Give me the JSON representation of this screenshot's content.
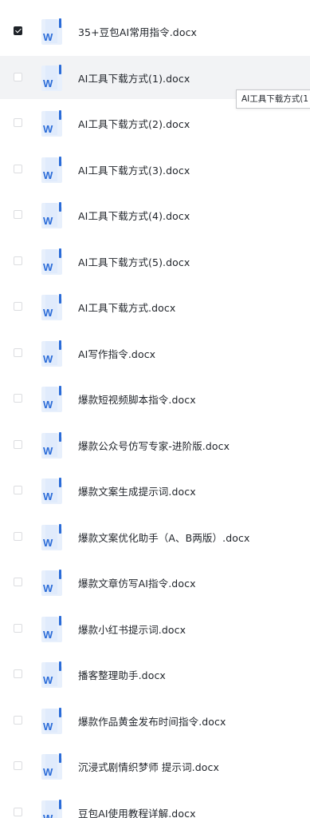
{
  "files": [
    {
      "name": "35+豆包AI常用指令.docx",
      "checked": true,
      "hovered": false
    },
    {
      "name": "AI工具下载方式(1).docx",
      "checked": false,
      "hovered": true
    },
    {
      "name": "AI工具下载方式(2).docx",
      "checked": false,
      "hovered": false
    },
    {
      "name": "AI工具下载方式(3).docx",
      "checked": false,
      "hovered": false
    },
    {
      "name": "AI工具下载方式(4).docx",
      "checked": false,
      "hovered": false
    },
    {
      "name": "AI工具下载方式(5).docx",
      "checked": false,
      "hovered": false
    },
    {
      "name": "AI工具下载方式.docx",
      "checked": false,
      "hovered": false
    },
    {
      "name": "AI写作指令.docx",
      "checked": false,
      "hovered": false
    },
    {
      "name": "爆款短视频脚本指令.docx",
      "checked": false,
      "hovered": false
    },
    {
      "name": "爆款公众号仿写专家-进阶版.docx",
      "checked": false,
      "hovered": false
    },
    {
      "name": "爆款文案生成提示词.docx",
      "checked": false,
      "hovered": false
    },
    {
      "name": "爆款文案优化助手（A、B两版）.docx",
      "checked": false,
      "hovered": false
    },
    {
      "name": "爆款文章仿写AI指令.docx",
      "checked": false,
      "hovered": false
    },
    {
      "name": "爆款小红书提示词.docx",
      "checked": false,
      "hovered": false
    },
    {
      "name": "播客整理助手.docx",
      "checked": false,
      "hovered": false
    },
    {
      "name": "爆款作品黄金发布时间指令.docx",
      "checked": false,
      "hovered": false
    },
    {
      "name": "沉浸式剧情织梦师 提示词.docx",
      "checked": false,
      "hovered": false
    },
    {
      "name": "豆包AI使用教程详解.docx",
      "checked": false,
      "hovered": false
    }
  ],
  "tooltip": {
    "text": "AI工具下载方式(1"
  },
  "icons": {
    "file_icon": "word-document-icon",
    "checkbox_checked": "checkmark-icon"
  },
  "colors": {
    "word_blue": "#2b6cd8",
    "word_light": "#e8f0fc",
    "hover_bg": "#f2f3f5",
    "text": "#1f2329"
  }
}
